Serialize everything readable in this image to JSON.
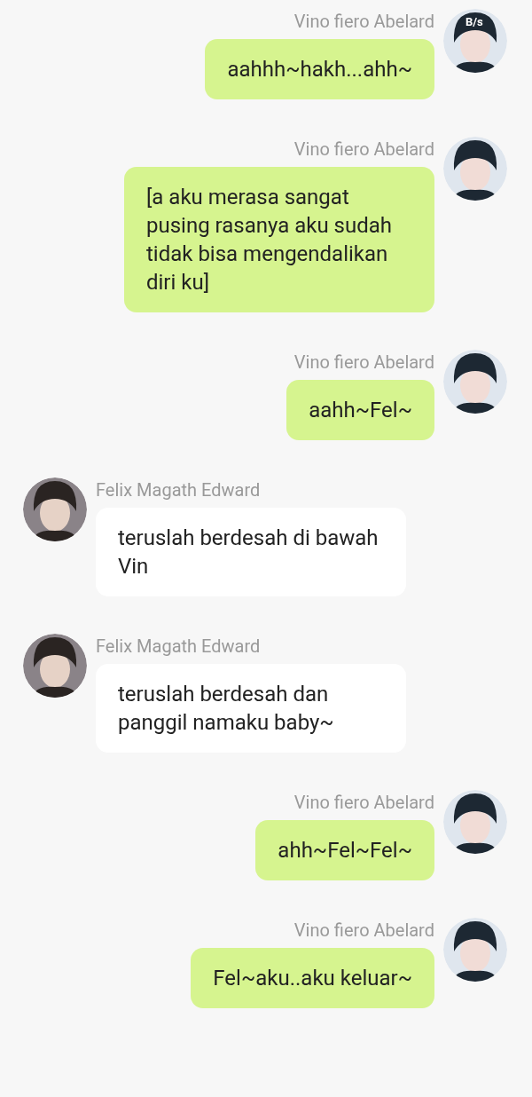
{
  "status_bar": {
    "speed": "B/s"
  },
  "messages": [
    {
      "kind": "self",
      "sender": "Vino fiero Abelard",
      "text": "aahhh~hakh...ahh~"
    },
    {
      "kind": "self",
      "sender": "Vino fiero Abelard",
      "text": "[a aku merasa sangat pusing rasanya aku sudah tidak bisa mengendalikan diri ku]"
    },
    {
      "kind": "self",
      "sender": "Vino fiero Abelard",
      "text": "aahh~Fel~"
    },
    {
      "kind": "other",
      "sender": "Felix Magath Edward",
      "text": "teruslah berdesah di bawah Vin"
    },
    {
      "kind": "other",
      "sender": "Felix Magath Edward",
      "text": "teruslah berdesah dan panggil namaku baby~"
    },
    {
      "kind": "self",
      "sender": "Vino fiero Abelard",
      "text": "ahh~Fel~Fel~"
    },
    {
      "kind": "self",
      "sender": "Vino fiero Abelard",
      "text": "Fel~aku..aku keluar~"
    }
  ]
}
